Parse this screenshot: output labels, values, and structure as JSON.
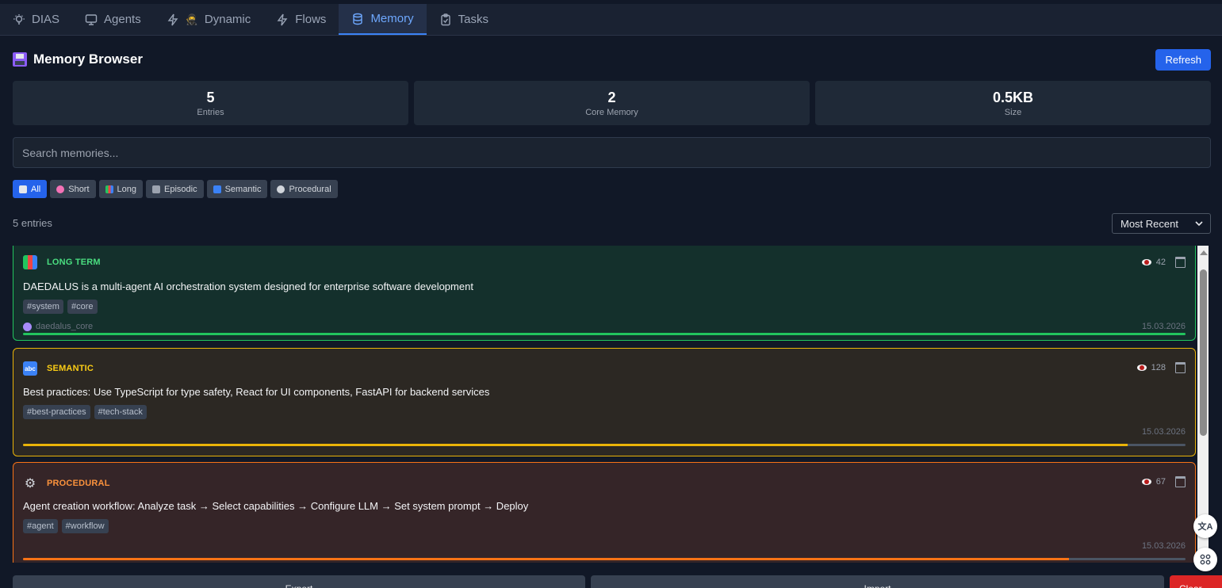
{
  "tabs": [
    {
      "label": "DIAS",
      "icon": "lightbulb-icon"
    },
    {
      "label": "Agents",
      "icon": "monitor-icon"
    },
    {
      "label": "Dynamic",
      "icon": "lightning-icon"
    },
    {
      "label": "Flows",
      "icon": "lightning-icon"
    },
    {
      "label": "Memory",
      "icon": "database-icon",
      "active": true
    },
    {
      "label": "Tasks",
      "icon": "clipboard-icon"
    }
  ],
  "header": {
    "title": "Memory Browser",
    "refresh_label": "Refresh"
  },
  "stats": [
    {
      "value": "5",
      "label": "Entries"
    },
    {
      "value": "2",
      "label": "Core Memory"
    },
    {
      "value": "0.5KB",
      "label": "Size"
    }
  ],
  "search": {
    "placeholder": "Search memories..."
  },
  "filters": [
    {
      "label": "All",
      "icon": "clipboard-icon",
      "active": true
    },
    {
      "label": "Short",
      "icon": "brain-icon"
    },
    {
      "label": "Long",
      "icon": "books-icon"
    },
    {
      "label": "Episodic",
      "icon": "film-icon"
    },
    {
      "label": "Semantic",
      "icon": "abc-icon"
    },
    {
      "label": "Procedural",
      "icon": "gear-icon"
    }
  ],
  "list_meta": {
    "count_text": "5 entries",
    "sort_value": "Most Recent"
  },
  "entries": [
    {
      "type": "LONG TERM",
      "views": "42",
      "content": "DAEDALUS is a multi-agent AI orchestration system designed for enterprise software development",
      "tags": [
        "#system",
        "#core"
      ],
      "source": "daedalus_core",
      "date": "15.03.2026",
      "importance": 1.0,
      "accent": "#22c55e"
    },
    {
      "type": "SEMANTIC",
      "views": "128",
      "content": "Best practices: Use TypeScript for type safety, React for UI components, FastAPI for backend services",
      "tags": [
        "#best-practices",
        "#tech-stack"
      ],
      "source": "",
      "date": "15.03.2026",
      "importance": 0.95,
      "accent": "#eab308"
    },
    {
      "type": "PROCEDURAL",
      "views": "67",
      "content": "Agent creation workflow: Analyze task → Select capabilities → Configure LLM → Set system prompt → Deploy",
      "tags": [
        "#agent",
        "#workflow"
      ],
      "source": "",
      "date": "15.03.2026",
      "importance": 0.9,
      "accent": "#f97316"
    }
  ],
  "footer": {
    "left_label": "Export",
    "mid_label": "Import",
    "right_label": "Clear"
  },
  "floating": {
    "translate_label": "文A",
    "grid_icon": "grid-icon"
  }
}
